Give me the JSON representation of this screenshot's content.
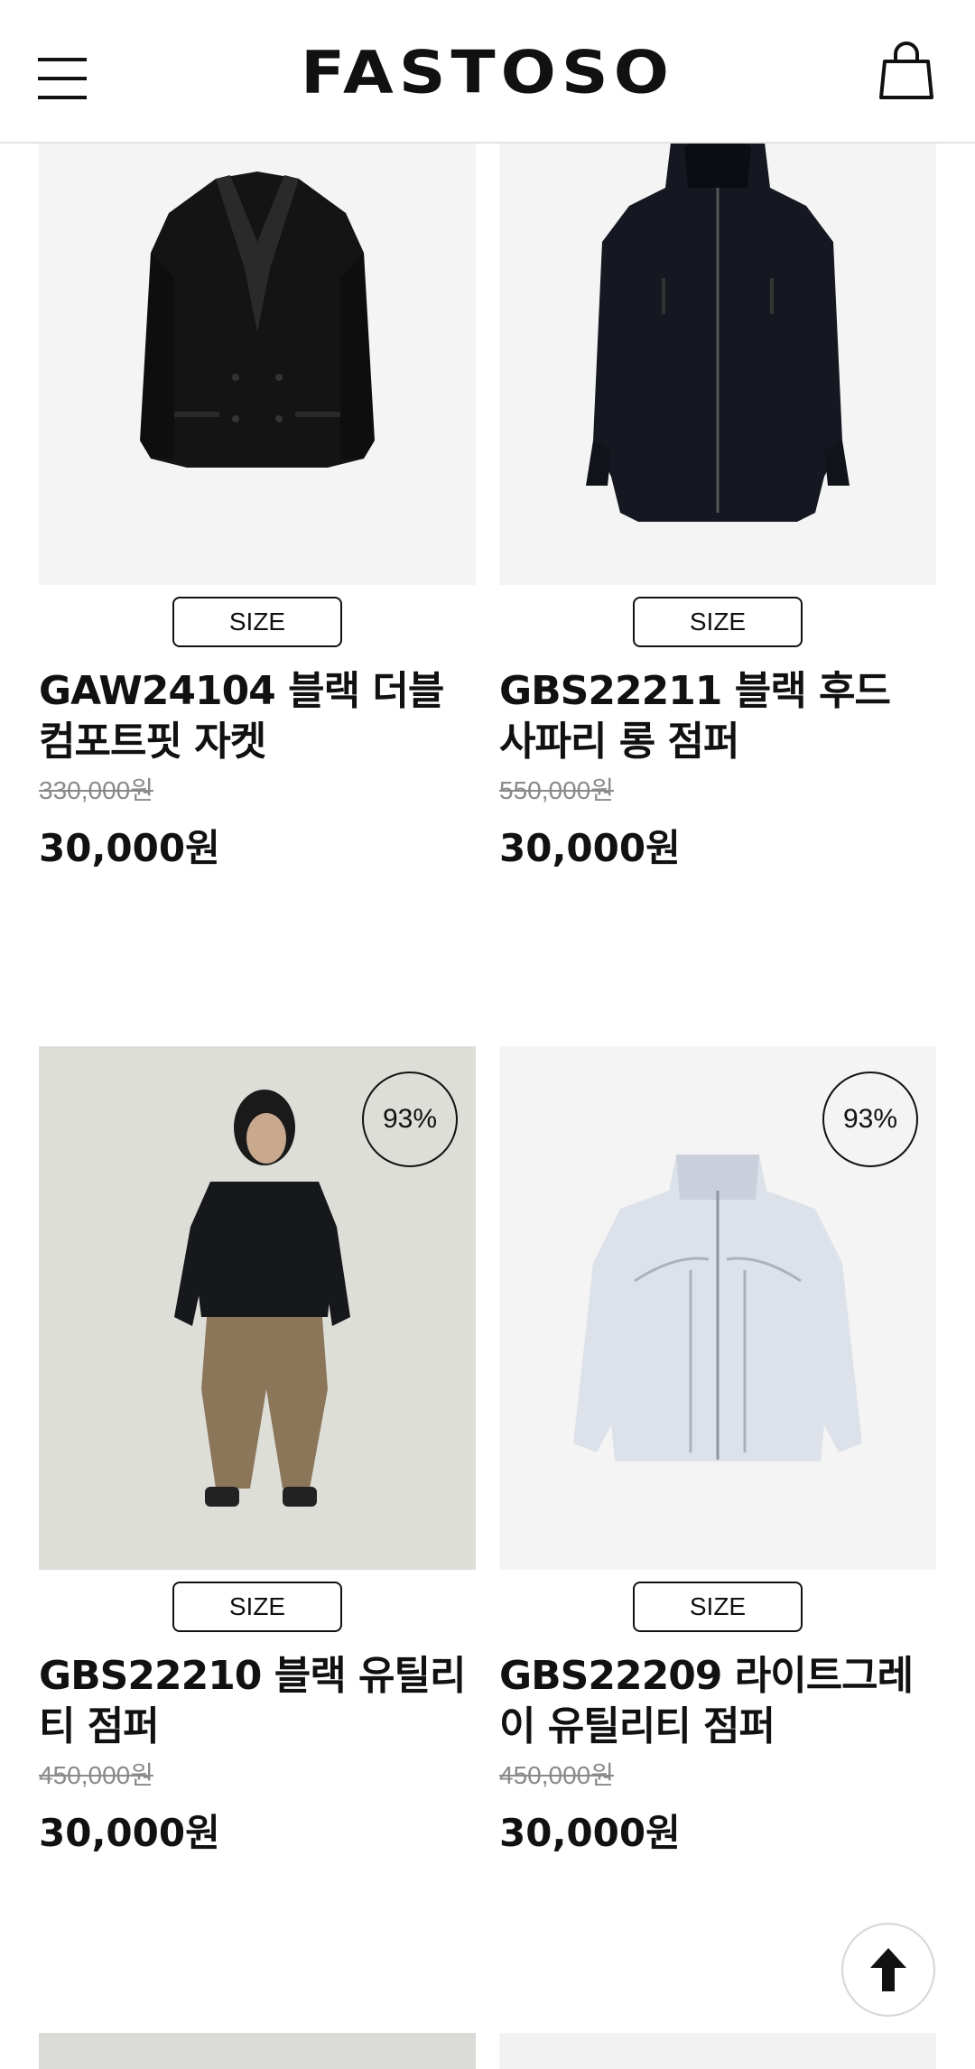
{
  "header": {
    "logo": "FASTOSO",
    "menu_icon": "hamburger-menu-icon",
    "cart_icon": "shopping-bag-icon"
  },
  "products": [
    {
      "name": "GAW24104 블랙 더블 컴포트핏 자켓",
      "original_price": "330,000원",
      "sale_price": "30,000원",
      "size_label": "SIZE",
      "discount": ""
    },
    {
      "name": "GBS22211 블랙 후드 사파리 롱 점퍼",
      "original_price": "550,000원",
      "sale_price": "30,000원",
      "size_label": "SIZE",
      "discount": ""
    },
    {
      "name": "GBS22210 블랙 유틸리티 점퍼",
      "original_price": "450,000원",
      "sale_price": "30,000원",
      "size_label": "SIZE",
      "discount": "93%"
    },
    {
      "name": "GBS22209 라이트그레이 유틸리티 점퍼",
      "original_price": "450,000원",
      "sale_price": "30,000원",
      "size_label": "SIZE",
      "discount": "93%"
    }
  ],
  "scroll_top_icon": "arrow-up-icon",
  "colors": {
    "text": "#111111",
    "strike": "#8a8a8a",
    "image_bg": "#f4f4f4"
  }
}
